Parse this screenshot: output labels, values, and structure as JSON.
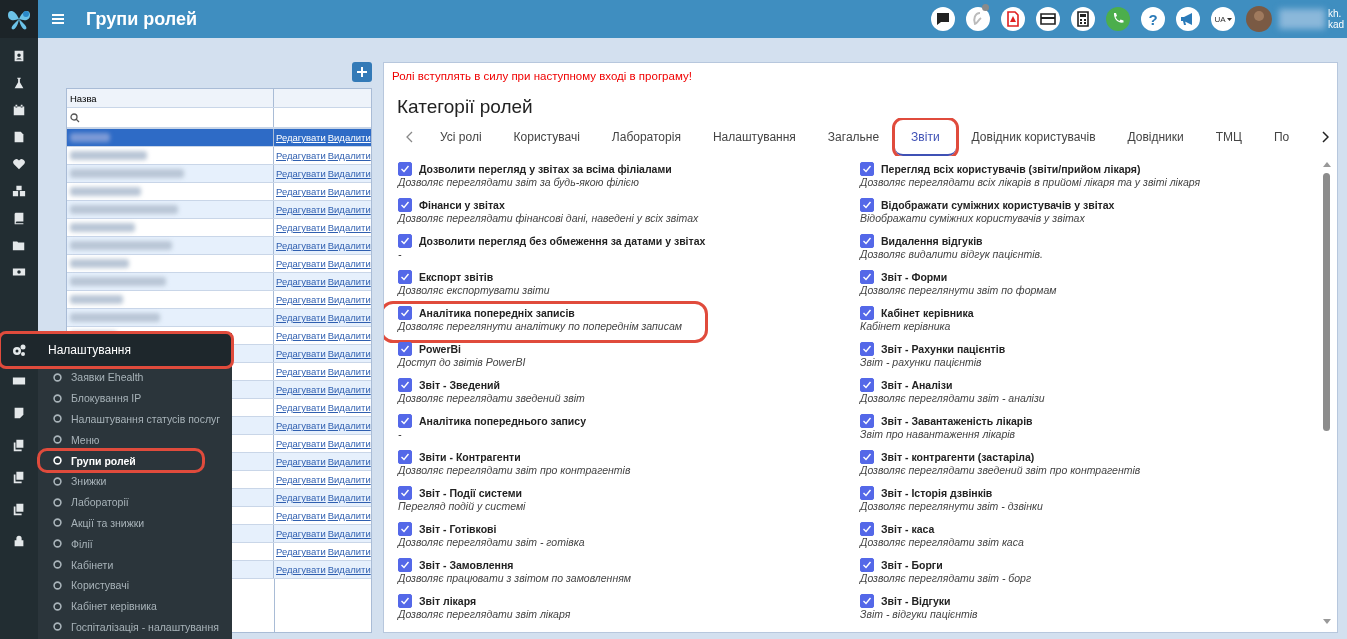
{
  "header": {
    "title": "Групи ролей",
    "help_label": "?",
    "language": "UA",
    "user_name": "kh.",
    "user_role": "kad"
  },
  "roles_table": {
    "column_name": "Назва",
    "rows": [
      {
        "selected": true,
        "edit": "Редагувати",
        "delete": "Видалити"
      },
      {
        "selected": false,
        "edit": "Редагувати",
        "delete": "Видалити"
      },
      {
        "selected": false,
        "edit": "Редагувати",
        "delete": "Видалити"
      },
      {
        "selected": false,
        "edit": "Редагувати",
        "delete": "Видалити"
      },
      {
        "selected": false,
        "edit": "Редагувати",
        "delete": "Видалити"
      },
      {
        "selected": false,
        "edit": "Редагувати",
        "delete": "Видалити"
      },
      {
        "selected": false,
        "edit": "Редагувати",
        "delete": "Видалити"
      },
      {
        "selected": false,
        "edit": "Редагувати",
        "delete": "Видалити"
      },
      {
        "selected": false,
        "edit": "Редагувати",
        "delete": "Видалити"
      },
      {
        "selected": false,
        "edit": "Редагувати",
        "delete": "Видалити"
      },
      {
        "selected": false,
        "edit": "Редагувати",
        "delete": "Видалити"
      },
      {
        "selected": false,
        "edit": "Редагувати",
        "delete": "Видалити"
      },
      {
        "selected": false,
        "edit": "Редагувати",
        "delete": "Видалити"
      },
      {
        "selected": false,
        "edit": "Редагувати",
        "delete": "Видалити"
      },
      {
        "selected": false,
        "edit": "Редагувати",
        "delete": "Видалити"
      },
      {
        "selected": false,
        "edit": "Редагувати",
        "delete": "Видалити"
      },
      {
        "selected": false,
        "edit": "Редагувати",
        "delete": "Видалити"
      },
      {
        "selected": false,
        "edit": "Редагувати",
        "delete": "Видалити"
      },
      {
        "selected": false,
        "edit": "Редагувати",
        "delete": "Видалити"
      },
      {
        "selected": false,
        "edit": "Редагувати",
        "delete": "Видалити"
      },
      {
        "selected": false,
        "edit": "Редагувати",
        "delete": "Видалити"
      },
      {
        "selected": false,
        "edit": "Редагувати",
        "delete": "Видалити"
      },
      {
        "selected": false,
        "edit": "Редагувати",
        "delete": "Видалити"
      },
      {
        "selected": false,
        "edit": "Редагувати",
        "delete": "Видалити"
      },
      {
        "selected": false,
        "edit": "Редагувати",
        "delete": "Видалити"
      }
    ]
  },
  "settings_menu": {
    "title": "Налаштування",
    "highlighted": true,
    "items": [
      {
        "label": "Заявки Ehealth",
        "selected": false,
        "highlighted": false
      },
      {
        "label": "Блокування IP",
        "selected": false,
        "highlighted": false
      },
      {
        "label": "Налаштування статусів послуг",
        "selected": false,
        "highlighted": false
      },
      {
        "label": "Меню",
        "selected": false,
        "highlighted": false
      },
      {
        "label": "Групи ролей",
        "selected": true,
        "highlighted": true
      },
      {
        "label": "Знижки",
        "selected": false,
        "highlighted": false
      },
      {
        "label": "Лабораторії",
        "selected": false,
        "highlighted": false
      },
      {
        "label": "Акції та знижки",
        "selected": false,
        "highlighted": false
      },
      {
        "label": "Філії",
        "selected": false,
        "highlighted": false
      },
      {
        "label": "Кабінети",
        "selected": false,
        "highlighted": false
      },
      {
        "label": "Користувачі",
        "selected": false,
        "highlighted": false
      },
      {
        "label": "Кабінет керівника",
        "selected": false,
        "highlighted": false
      },
      {
        "label": "Госпіталізація - налаштування",
        "selected": false,
        "highlighted": false
      }
    ]
  },
  "notice": "Ролі вступлять в силу при наступному вході в програму!",
  "categories": {
    "title": "Категорії ролей",
    "tabs": [
      {
        "label": "Усі ролі",
        "selected": false,
        "highlighted": false
      },
      {
        "label": "Користувачі",
        "selected": false,
        "highlighted": false
      },
      {
        "label": "Лабораторія",
        "selected": false,
        "highlighted": false
      },
      {
        "label": "Налаштування",
        "selected": false,
        "highlighted": false
      },
      {
        "label": "Загальне",
        "selected": false,
        "highlighted": false
      },
      {
        "label": "Звіти",
        "selected": true,
        "highlighted": true
      },
      {
        "label": "Довідник користувачів",
        "selected": false,
        "highlighted": false
      },
      {
        "label": "Довідники",
        "selected": false,
        "highlighted": false
      },
      {
        "label": "ТМЦ",
        "selected": false,
        "highlighted": false
      },
      {
        "label": "По",
        "selected": false,
        "highlighted": false
      }
    ],
    "permissions_left": [
      {
        "label": "Дозволити перегляд у звітах за всіма філіалами",
        "description": "Дозволяє переглядати звіт за будь-якою філією",
        "checked": true,
        "highlighted": false
      },
      {
        "label": "Фінанси у звітах",
        "description": "Дозволяє переглядати фінансові дані, наведені у всіх звітах",
        "checked": true,
        "highlighted": false
      },
      {
        "label": "Дозволити перегляд без обмеження за датами у звітах",
        "description": "-",
        "checked": true,
        "highlighted": false
      },
      {
        "label": "Експорт звітів",
        "description": "Дозволяє експортувати звіти",
        "checked": true,
        "highlighted": false
      },
      {
        "label": "Аналітика попередніх записів",
        "description": "Дозволяє переглянути аналітику по попереднім записам",
        "checked": true,
        "highlighted": true
      },
      {
        "label": "PowerBi",
        "description": "Доступ до звітів PowerBI",
        "checked": true,
        "highlighted": false
      },
      {
        "label": "Звіт - Зведений",
        "description": "Дозволяє переглядати зведений звіт",
        "checked": true,
        "highlighted": false
      },
      {
        "label": "Аналітика попереднього запису",
        "description": "-",
        "checked": true,
        "highlighted": false
      },
      {
        "label": "Звіти - Контрагенти",
        "description": "Дозволяє переглядати звіт про контрагентів",
        "checked": true,
        "highlighted": false
      },
      {
        "label": "Звіт - Події системи",
        "description": "Перегляд подій у системі",
        "checked": true,
        "highlighted": false
      },
      {
        "label": "Звіт - Готівкові",
        "description": "Дозволяє переглядати звіт - готівка",
        "checked": true,
        "highlighted": false
      },
      {
        "label": "Звіт - Замовлення",
        "description": "Дозволяє працювати з звітом по замовленням",
        "checked": true,
        "highlighted": false
      },
      {
        "label": "Звіт лікаря",
        "description": "Дозволяє переглядати звіт лікаря",
        "checked": true,
        "highlighted": false
      }
    ],
    "permissions_right": [
      {
        "label": "Перегляд всіх користувачів (звіти/прийом лікаря)",
        "description": "Дозволяє переглядати всіх лікарів в прийомі лікаря та у звіті лікаря",
        "checked": true,
        "highlighted": false
      },
      {
        "label": "Відображати суміжних користувачів у звітах",
        "description": "Відображати суміжних користувачів у звітах",
        "checked": true,
        "highlighted": false
      },
      {
        "label": "Видалення відгуків",
        "description": "Дозволяє видалити відгук пацієнтів.",
        "checked": true,
        "highlighted": false
      },
      {
        "label": "Звіт - Форми",
        "description": "Дозволяє переглянути звіт по формам",
        "checked": true,
        "highlighted": false
      },
      {
        "label": "Кабінет керівника",
        "description": "Кабінет керівника",
        "checked": true,
        "highlighted": false
      },
      {
        "label": "Звіт - Рахунки пацієнтів",
        "description": "Звіт - рахунки пацієнтів",
        "checked": true,
        "highlighted": false
      },
      {
        "label": "Звіт - Аналізи",
        "description": "Дозволяє переглядати звіт - аналізи",
        "checked": true,
        "highlighted": false
      },
      {
        "label": "Звіт - Завантаженість лікарів",
        "description": "Звіт про навантаження лікарів",
        "checked": true,
        "highlighted": false
      },
      {
        "label": "Звіт - контрагенти (застаріла)",
        "description": "Дозволяє переглядати зведений звіт про контрагентів",
        "checked": true,
        "highlighted": false
      },
      {
        "label": "Звіт - Історія дзвінків",
        "description": "Дозволяє переглянути звіт - дзвінки",
        "checked": true,
        "highlighted": false
      },
      {
        "label": "Звіт - каса",
        "description": "Дозволяє переглядати звіт каса",
        "checked": true,
        "highlighted": false
      },
      {
        "label": "Звіт - Борги",
        "description": "Дозволяє переглядати звіт - борг",
        "checked": true,
        "highlighted": false
      },
      {
        "label": "Звіт - Відгуки",
        "description": "Звіт - відгуки пацієнтів",
        "checked": true,
        "highlighted": false
      }
    ]
  }
}
